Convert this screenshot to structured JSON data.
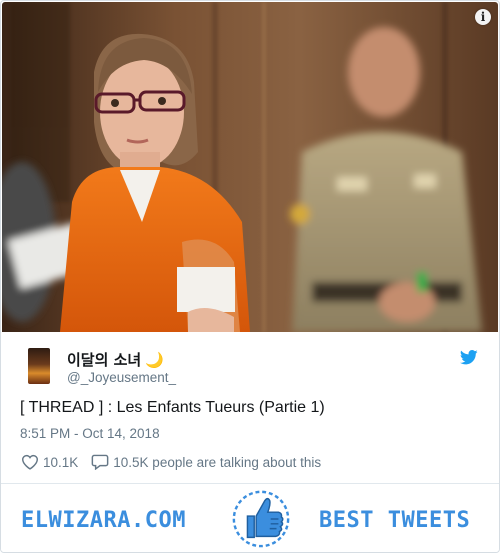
{
  "photo": {
    "description_icon": "info-icon",
    "info_label": "i"
  },
  "tweet": {
    "display_name": "이달의 소녀",
    "name_emoji": "🌙",
    "handle": "@_Joyeusement_",
    "text": "[ THREAD ] : Les Enfants Tueurs (Partie 1)",
    "timestamp": "8:51 PM - Oct 14, 2018",
    "likes": "10.1K",
    "replies_text": "10.5K people are talking about this",
    "icons": {
      "like": "heart-icon",
      "reply": "comment-icon",
      "brand": "twitter-bird-icon"
    }
  },
  "footer": {
    "brand": "ELWIZARA.COM",
    "tagline": "BEST TWEETS",
    "icon": "thumbs-up-icon"
  },
  "colors": {
    "accent": "#3b8ede",
    "twitter_blue": "#1da1f2",
    "muted": "#657786",
    "text": "#14171a"
  }
}
